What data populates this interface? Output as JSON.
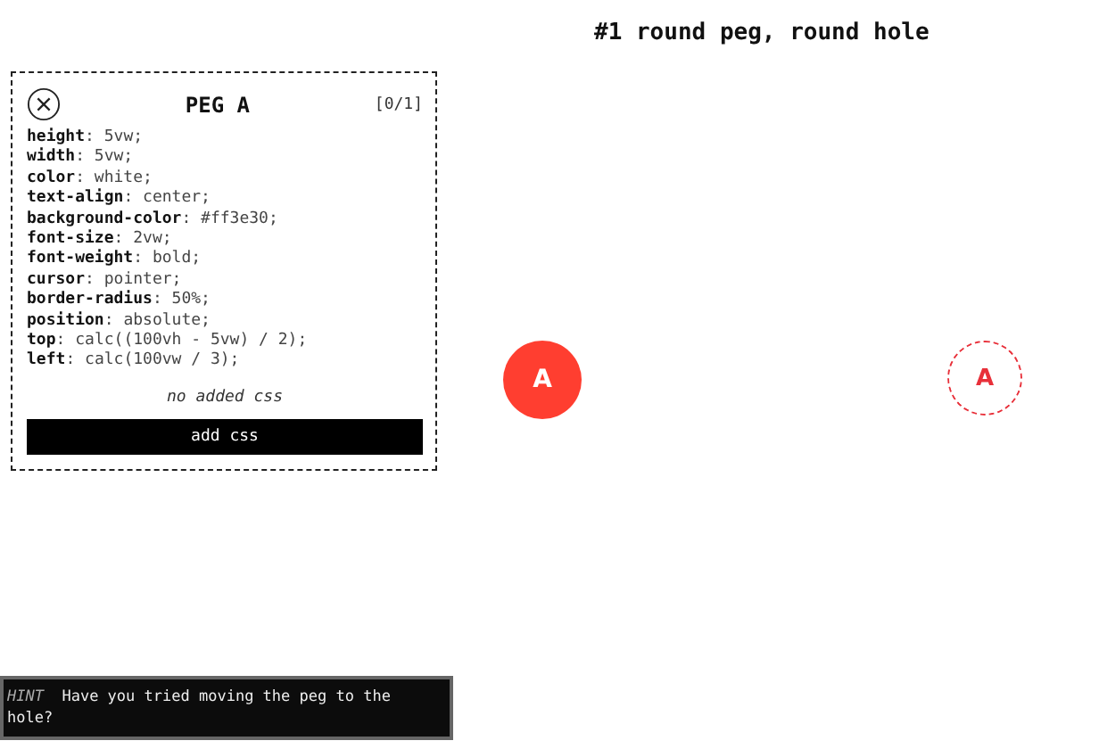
{
  "level_title": "#1 round peg, round hole",
  "panel": {
    "title": "PEG A",
    "counter": "[0/1]",
    "css": [
      "**height**: 5vw;",
      "**width**: 5vw;",
      "**color**: white;",
      "**text-align**: center;",
      "**background-color**: #ff3e30;",
      "**font-size**: 2vw;",
      "**font-weight**: bold;",
      "**cursor**: pointer;",
      "**border-radius**: 50%;",
      "**position**: absolute;",
      "**top**: calc((100vh - 5vw) / 2);",
      "**left**: calc(100vw / 3);"
    ],
    "added_note": "no added css",
    "button": "add css"
  },
  "peg": {
    "label": "A",
    "color": "#ff3e30"
  },
  "hole": {
    "label": "A",
    "color": "#e8303a"
  },
  "hint": {
    "tag": "HINT",
    "text": "Have you tried moving the peg to the hole?"
  }
}
